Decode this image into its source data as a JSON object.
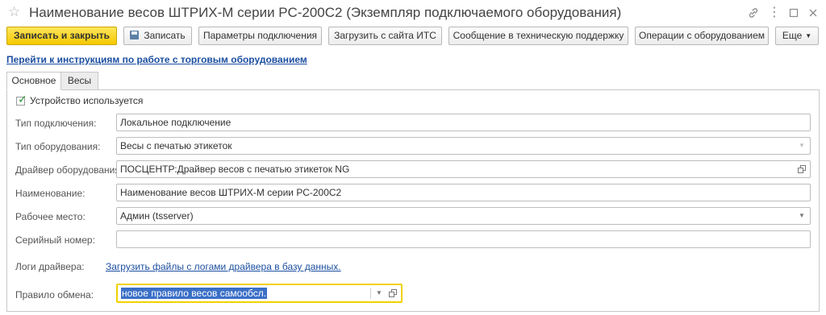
{
  "window": {
    "title": "Наименование весов ШТРИХ-М серии РС-200С2 (Экземпляр подключаемого оборудования)",
    "icons": [
      "star-icon",
      "link-icon",
      "more-icon",
      "maximize-icon",
      "close-icon"
    ],
    "icon_glyphs": {
      "star": "☆",
      "link": "🔗",
      "more": "⋮",
      "maximize": "☐",
      "close": "✕"
    }
  },
  "toolbar": {
    "save_close": "Записать и закрыть",
    "save": "Записать",
    "connection_params": "Параметры подключения",
    "load_its": "Загрузить с сайта ИТС",
    "support_message": "Сообщение в техническую поддержку",
    "equipment_ops": "Операции с оборудованием",
    "more": "Еще"
  },
  "help_link": "Перейти к инструкциям по работе с торговым оборудованием",
  "tabs": [
    {
      "label": "Основное",
      "active": true
    },
    {
      "label": "Весы",
      "active": false
    }
  ],
  "form": {
    "device_used": {
      "label": "Устройство используется",
      "checked": true
    },
    "connection_type": {
      "label": "Тип подключения:",
      "value": "Локальное подключение"
    },
    "equipment_type": {
      "label": "Тип оборудования:",
      "value": "Весы с печатью этикеток"
    },
    "driver": {
      "label": "Драйвер оборудования:",
      "value": "ПОСЦЕНТР:Драйвер весов с печатью этикеток NG"
    },
    "name": {
      "label": "Наименование:",
      "value": "Наименование весов ШТРИХ-М серии РС-200С2"
    },
    "workplace": {
      "label": "Рабочее место:",
      "value": "Админ (tsserver)"
    },
    "serial": {
      "label": "Серийный номер:",
      "value": ""
    },
    "driver_logs": {
      "label": "Логи драйвера:",
      "link": "Загрузить файлы с логами драйвера в базу данных."
    },
    "exchange_rule": {
      "label": "Правило обмена:",
      "value": "новое правило весов самообсл."
    }
  },
  "colors": {
    "primary_button": "#f5c900",
    "link": "#1c4fa0",
    "focus_border": "#f2d100",
    "selection": "#3a6fc7",
    "check": "#2e9b3a"
  }
}
